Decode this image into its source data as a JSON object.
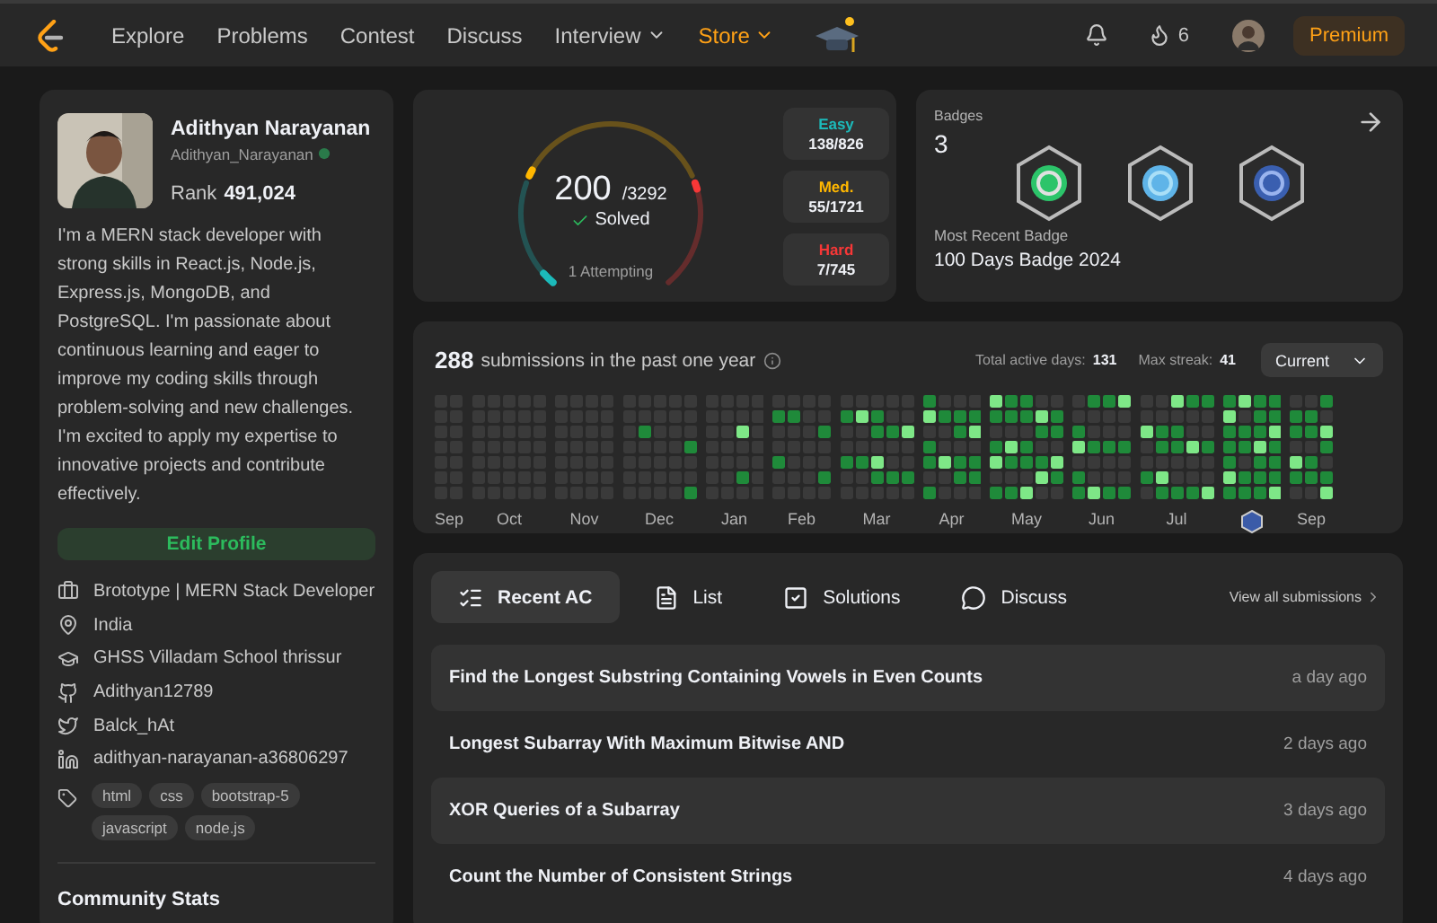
{
  "nav": {
    "items": [
      {
        "label": "Explore",
        "kind": "link"
      },
      {
        "label": "Problems",
        "kind": "link"
      },
      {
        "label": "Contest",
        "kind": "link"
      },
      {
        "label": "Discuss",
        "kind": "link"
      },
      {
        "label": "Interview",
        "kind": "menu"
      },
      {
        "label": "Store",
        "kind": "store"
      }
    ],
    "streak": "6",
    "premium": "Premium"
  },
  "profile": {
    "name": "Adithyan Narayanan",
    "username": "Adithyan_Narayanan",
    "rank_label": "Rank",
    "rank": "491,024",
    "bio": "I'm a MERN stack developer with strong skills in React.js, Node.js, Express.js, MongoDB, and PostgreSQL. I'm passionate about continuous learning and eager to improve my coding skills through problem-solving and new challenges. I'm excited to apply my expertise to innovative projects and contribute effectively.",
    "edit": "Edit Profile",
    "info": [
      {
        "kind": "work",
        "text": "Brototype | MERN Stack Developer"
      },
      {
        "kind": "location",
        "text": "India"
      },
      {
        "kind": "school",
        "text": "GHSS Villadam School thrissur"
      },
      {
        "kind": "github",
        "text": "Adithyan12789"
      },
      {
        "kind": "twitter",
        "text": "Balck_hAt"
      },
      {
        "kind": "linkedin",
        "text": "adithyan-narayanan-a36806297"
      }
    ],
    "tags": [
      "html",
      "css",
      "bootstrap-5",
      "javascript",
      "node.js"
    ],
    "community": "Community Stats"
  },
  "solved": {
    "count": "200",
    "total": "/3292",
    "label": "Solved",
    "attempting": "1 Attempting",
    "levels": [
      {
        "name": "Easy",
        "value": "138/826",
        "color": "#1cbaba"
      },
      {
        "name": "Med.",
        "value": "55/1721",
        "color": "#ffb700"
      },
      {
        "name": "Hard",
        "value": "7/745",
        "color": "#f63737"
      }
    ]
  },
  "badges": {
    "title": "Badges",
    "count": "3",
    "recent_label": "Most Recent Badge",
    "recent": "100 Days Badge 2024"
  },
  "activity": {
    "count": "288",
    "text": "submissions in the past one year",
    "active_label": "Total active days:",
    "active": "131",
    "streak_label": "Max streak:",
    "streak": "41",
    "period": "Current",
    "months": [
      {
        "kind": "month",
        "label": "Sep"
      },
      {
        "kind": "month",
        "label": "Oct"
      },
      {
        "kind": "month",
        "label": "Nov"
      },
      {
        "kind": "month",
        "label": "Dec"
      },
      {
        "kind": "month",
        "label": "Jan"
      },
      {
        "kind": "month",
        "label": "Feb"
      },
      {
        "kind": "month",
        "label": "Mar"
      },
      {
        "kind": "month",
        "label": "Apr"
      },
      {
        "kind": "month",
        "label": "May"
      },
      {
        "kind": "month",
        "label": "Jun"
      },
      {
        "kind": "month",
        "label": "Jul"
      },
      {
        "kind": "badge"
      },
      {
        "kind": "month",
        "label": "Sep"
      }
    ]
  },
  "tabs": [
    {
      "label": "Recent AC",
      "kind": "recent",
      "selected": true
    },
    {
      "label": "List",
      "kind": "list",
      "selected": false
    },
    {
      "label": "Solutions",
      "kind": "solutions",
      "selected": false
    },
    {
      "label": "Discuss",
      "kind": "discuss",
      "selected": false
    }
  ],
  "view_all": "View all submissions",
  "submissions": [
    {
      "title": "Find the Longest Substring Containing Vowels in Even Counts",
      "time": "a day ago"
    },
    {
      "title": "Longest Subarray With Maximum Bitwise AND",
      "time": "2 days ago"
    },
    {
      "title": "XOR Queries of a Subarray",
      "time": "3 days ago"
    },
    {
      "title": "Count the Number of Consistent Strings",
      "time": "4 days ago"
    }
  ]
}
